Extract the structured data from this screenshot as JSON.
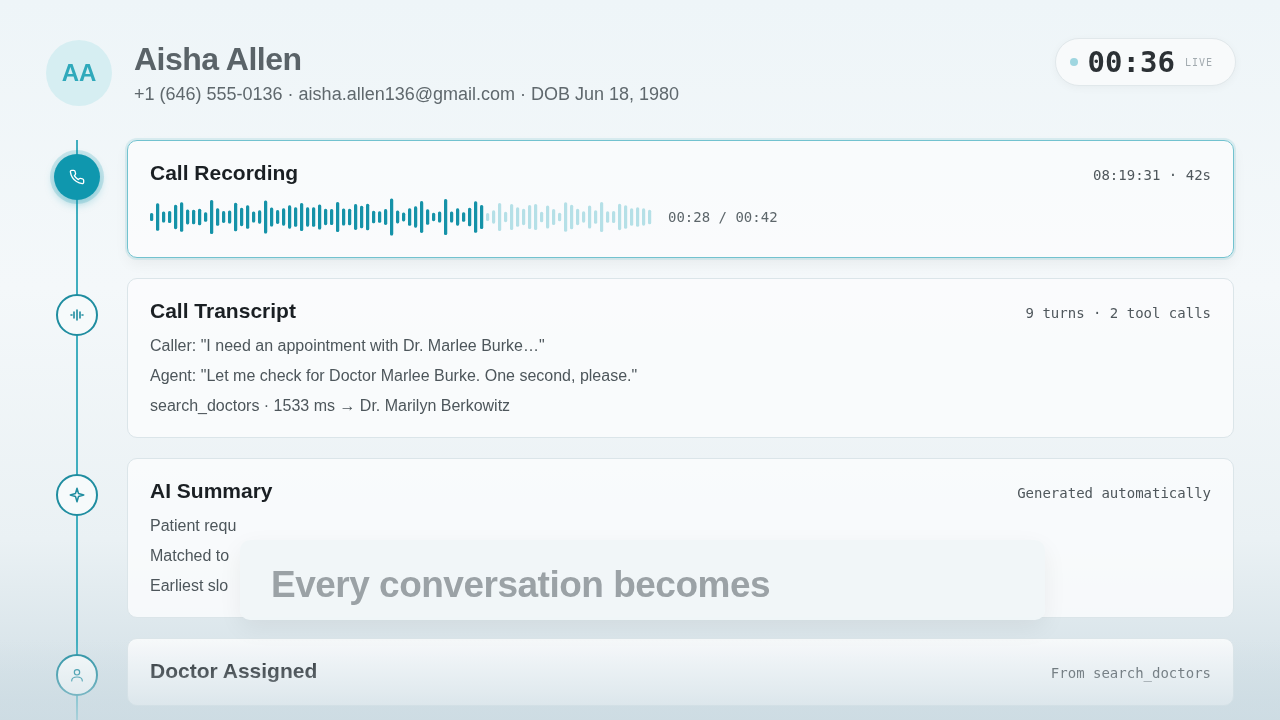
{
  "patient": {
    "initials": "AA",
    "name": "Aisha Allen",
    "details": "+1 (646) 555-0136 · aisha.allen136@gmail.com · DOB Jun 18, 1980"
  },
  "timer": {
    "time": "00:36",
    "label": "LIVE"
  },
  "steps": [
    {
      "kind": "recording",
      "active": true,
      "title": "Call Recording",
      "meta": "08:19:31 · 42s",
      "level": 0.667,
      "position": "00:28 / 00:42"
    },
    {
      "kind": "lines",
      "active": false,
      "title": "Call Transcript",
      "meta": "9 turns · 2 tool calls",
      "lines": [
        "Caller: \"I need an appointment with Dr. Marlee Burke…\"",
        "Agent: \"Let me check for Doctor Marlee Burke. One second, please.\"",
        "search_doctors · 1533 ms → Dr. Marilyn Berkowitz"
      ]
    },
    {
      "kind": "lines",
      "active": false,
      "title": "AI Summary",
      "meta": "Generated automatically",
      "lines": [
        "Patient requ",
        "Matched to",
        "Earliest slo"
      ]
    },
    {
      "kind": "lines",
      "active": false,
      "title": "Doctor Assigned",
      "meta": "From search_doctors"
    }
  ],
  "caption": "Every conversation becomes"
}
